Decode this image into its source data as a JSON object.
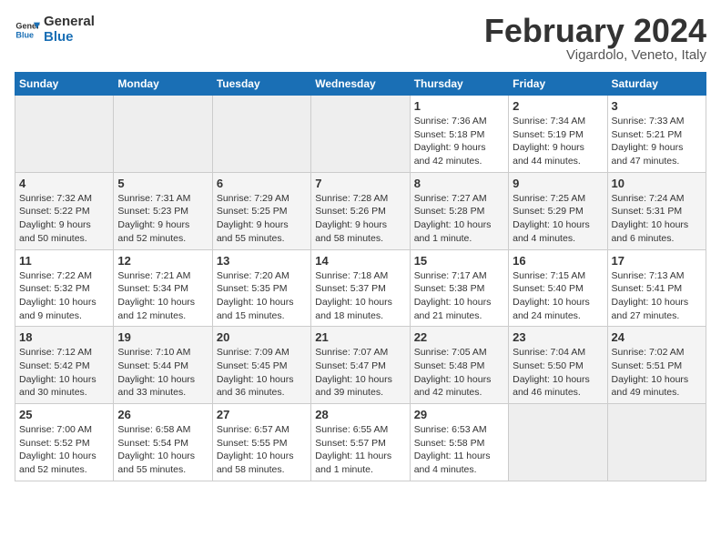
{
  "logo": {
    "line1": "General",
    "line2": "Blue"
  },
  "title": "February 2024",
  "subtitle": "Vigardolo, Veneto, Italy",
  "days_of_week": [
    "Sunday",
    "Monday",
    "Tuesday",
    "Wednesday",
    "Thursday",
    "Friday",
    "Saturday"
  ],
  "weeks": [
    [
      {
        "day": "",
        "info": ""
      },
      {
        "day": "",
        "info": ""
      },
      {
        "day": "",
        "info": ""
      },
      {
        "day": "",
        "info": ""
      },
      {
        "day": "1",
        "info": "Sunrise: 7:36 AM\nSunset: 5:18 PM\nDaylight: 9 hours\nand 42 minutes."
      },
      {
        "day": "2",
        "info": "Sunrise: 7:34 AM\nSunset: 5:19 PM\nDaylight: 9 hours\nand 44 minutes."
      },
      {
        "day": "3",
        "info": "Sunrise: 7:33 AM\nSunset: 5:21 PM\nDaylight: 9 hours\nand 47 minutes."
      }
    ],
    [
      {
        "day": "4",
        "info": "Sunrise: 7:32 AM\nSunset: 5:22 PM\nDaylight: 9 hours\nand 50 minutes."
      },
      {
        "day": "5",
        "info": "Sunrise: 7:31 AM\nSunset: 5:23 PM\nDaylight: 9 hours\nand 52 minutes."
      },
      {
        "day": "6",
        "info": "Sunrise: 7:29 AM\nSunset: 5:25 PM\nDaylight: 9 hours\nand 55 minutes."
      },
      {
        "day": "7",
        "info": "Sunrise: 7:28 AM\nSunset: 5:26 PM\nDaylight: 9 hours\nand 58 minutes."
      },
      {
        "day": "8",
        "info": "Sunrise: 7:27 AM\nSunset: 5:28 PM\nDaylight: 10 hours\nand 1 minute."
      },
      {
        "day": "9",
        "info": "Sunrise: 7:25 AM\nSunset: 5:29 PM\nDaylight: 10 hours\nand 4 minutes."
      },
      {
        "day": "10",
        "info": "Sunrise: 7:24 AM\nSunset: 5:31 PM\nDaylight: 10 hours\nand 6 minutes."
      }
    ],
    [
      {
        "day": "11",
        "info": "Sunrise: 7:22 AM\nSunset: 5:32 PM\nDaylight: 10 hours\nand 9 minutes."
      },
      {
        "day": "12",
        "info": "Sunrise: 7:21 AM\nSunset: 5:34 PM\nDaylight: 10 hours\nand 12 minutes."
      },
      {
        "day": "13",
        "info": "Sunrise: 7:20 AM\nSunset: 5:35 PM\nDaylight: 10 hours\nand 15 minutes."
      },
      {
        "day": "14",
        "info": "Sunrise: 7:18 AM\nSunset: 5:37 PM\nDaylight: 10 hours\nand 18 minutes."
      },
      {
        "day": "15",
        "info": "Sunrise: 7:17 AM\nSunset: 5:38 PM\nDaylight: 10 hours\nand 21 minutes."
      },
      {
        "day": "16",
        "info": "Sunrise: 7:15 AM\nSunset: 5:40 PM\nDaylight: 10 hours\nand 24 minutes."
      },
      {
        "day": "17",
        "info": "Sunrise: 7:13 AM\nSunset: 5:41 PM\nDaylight: 10 hours\nand 27 minutes."
      }
    ],
    [
      {
        "day": "18",
        "info": "Sunrise: 7:12 AM\nSunset: 5:42 PM\nDaylight: 10 hours\nand 30 minutes."
      },
      {
        "day": "19",
        "info": "Sunrise: 7:10 AM\nSunset: 5:44 PM\nDaylight: 10 hours\nand 33 minutes."
      },
      {
        "day": "20",
        "info": "Sunrise: 7:09 AM\nSunset: 5:45 PM\nDaylight: 10 hours\nand 36 minutes."
      },
      {
        "day": "21",
        "info": "Sunrise: 7:07 AM\nSunset: 5:47 PM\nDaylight: 10 hours\nand 39 minutes."
      },
      {
        "day": "22",
        "info": "Sunrise: 7:05 AM\nSunset: 5:48 PM\nDaylight: 10 hours\nand 42 minutes."
      },
      {
        "day": "23",
        "info": "Sunrise: 7:04 AM\nSunset: 5:50 PM\nDaylight: 10 hours\nand 46 minutes."
      },
      {
        "day": "24",
        "info": "Sunrise: 7:02 AM\nSunset: 5:51 PM\nDaylight: 10 hours\nand 49 minutes."
      }
    ],
    [
      {
        "day": "25",
        "info": "Sunrise: 7:00 AM\nSunset: 5:52 PM\nDaylight: 10 hours\nand 52 minutes."
      },
      {
        "day": "26",
        "info": "Sunrise: 6:58 AM\nSunset: 5:54 PM\nDaylight: 10 hours\nand 55 minutes."
      },
      {
        "day": "27",
        "info": "Sunrise: 6:57 AM\nSunset: 5:55 PM\nDaylight: 10 hours\nand 58 minutes."
      },
      {
        "day": "28",
        "info": "Sunrise: 6:55 AM\nSunset: 5:57 PM\nDaylight: 11 hours\nand 1 minute."
      },
      {
        "day": "29",
        "info": "Sunrise: 6:53 AM\nSunset: 5:58 PM\nDaylight: 11 hours\nand 4 minutes."
      },
      {
        "day": "",
        "info": ""
      },
      {
        "day": "",
        "info": ""
      }
    ]
  ]
}
